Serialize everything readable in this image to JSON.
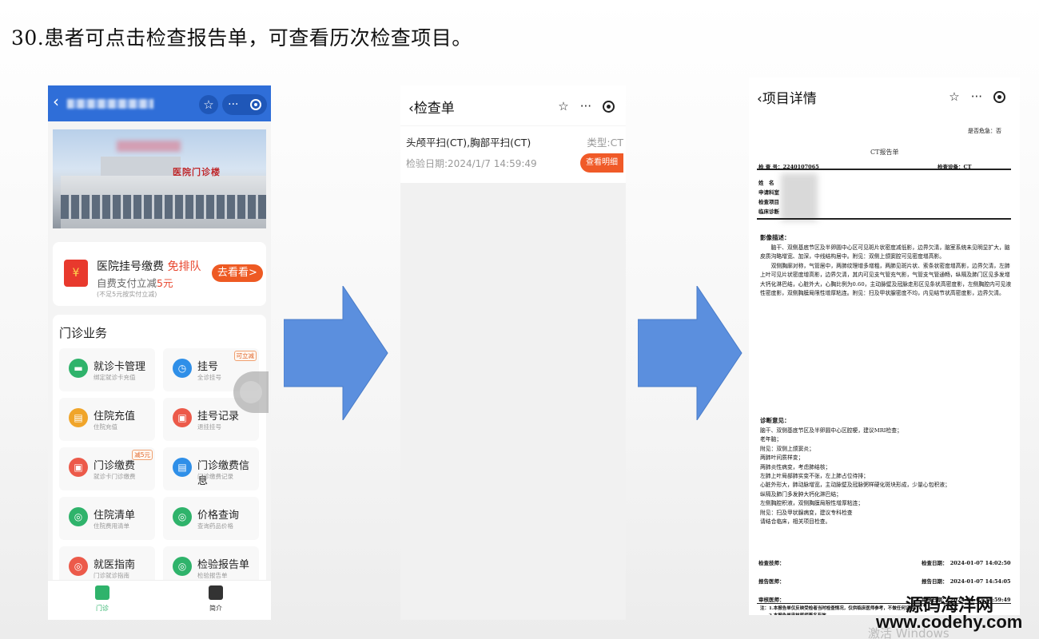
{
  "slide": {
    "title": "30.患者可点击检查报告单，可查看历次检查项目。"
  },
  "phone1": {
    "back_icon": "‹",
    "star_icon": "☆",
    "more_icon": "···",
    "banner_sign": "医院门诊楼",
    "promo": {
      "title": "医院挂号缴费",
      "title_highlight": "免排队",
      "subtitle": "自费支付立减",
      "subtitle_amount": "5元",
      "note": "(不足5元按实付立减)",
      "button": "去看看>"
    },
    "services_title": "门诊业务",
    "tiles": [
      {
        "name": "就诊卡管理",
        "desc": "绑定就诊卡充值",
        "color": "#2fb36b",
        "badge": ""
      },
      {
        "name": "挂号",
        "desc": "全诊挂号",
        "color": "#2f8fe8",
        "badge": "可立减"
      },
      {
        "name": "住院充值",
        "desc": "住院充值",
        "color": "#f0a52a",
        "badge": ""
      },
      {
        "name": "挂号记录",
        "desc": "退挂挂号",
        "color": "#ec5a4a",
        "badge": ""
      },
      {
        "name": "门诊缴费",
        "desc": "就诊卡门诊缴费",
        "color": "#ec5a4a",
        "badge": "减5元"
      },
      {
        "name": "门诊缴费信息",
        "desc": "门诊缴费记录",
        "color": "#2f8fe8",
        "badge": ""
      },
      {
        "name": "住院清单",
        "desc": "住院费用清单",
        "color": "#2fb36b",
        "badge": ""
      },
      {
        "name": "价格查询",
        "desc": "查询药品价格",
        "color": "#2fb36b",
        "badge": ""
      },
      {
        "name": "就医指南",
        "desc": "门诊就诊指南",
        "color": "#ec5a4a",
        "badge": ""
      },
      {
        "name": "检验报告单",
        "desc": "检验报告单",
        "color": "#2fb36b",
        "badge": ""
      }
    ],
    "tabs": [
      {
        "label": "门诊",
        "color": "#2fb36b"
      },
      {
        "label": "简介",
        "color": "#333333"
      }
    ]
  },
  "phone2": {
    "title": "检查单",
    "record": {
      "name": "头颅平扫(CT),胸部平扫(CT)",
      "type": "类型:CT",
      "date": "检验日期:2024/1/7 14:59:49",
      "button": "查看明细"
    }
  },
  "phone3": {
    "title": "项目详情",
    "report": {
      "emergency": "是否危急：否",
      "title": "CT报告单",
      "exam_no": "检 查 号：2240107065",
      "device": "检查设备：CT",
      "fields": [
        "姓　名",
        "申请科室",
        "检查项目",
        "临床诊断"
      ],
      "imaging_title": "影像描述：",
      "imaging_paras": [
        "脑干、双侧基底节区及半卵圆中心区可见斑片状密度减低影，边界欠清，脑室系统未见明显扩大，脑皮质沟略增宽、加深，中线结构居中。附见：双侧上颌窦腔可见密度增高影。",
        "双侧胸廓对称，气管居中，两肺纹理增多增粗，两肺见斑片状、索条状密度增高影，边界欠清，左肺上叶可见片状密度增高影，边界欠清，其内可见支气管充气影，气管支气管通畅，纵隔及肺门区见多发增大钙化淋巴结，心脏外大，心胸比例为0.60，主动脉壁及冠脉走形区见条状高密度影，左侧胸腔内可见液性密度影，双侧胸膜局限性增厚粘连。附见：扫及甲状腺密度不均，内见结节状高密度影，边界欠清。"
      ],
      "diagnosis_title": "诊断意见：",
      "diagnosis_lines": [
        "脑干、双侧基底节区及半卵圆中心区腔梗，建议MRI检查；",
        "老年脑；",
        "附见：双侧上颌窦炎；",
        "两肺叶间质样变；",
        "两肺炎性病变，考虑肺结核；",
        "左肺上叶局部肺实变不张，左上肺占位待排；",
        "心脏外形大，肺动脉增宽，主动脉壁及冠脉粥样硬化斑块形成，少量心包积液；",
        "纵隔及肺门多发肿大钙化淋巴结；",
        "左侧胸腔积液，双侧胸膜局限性增厚粘连；",
        "附见：扫及甲状腺病变，建议专科检查",
        "请结合临床，相关项目检查。"
      ],
      "signatures": [
        {
          "label": "检查技师：",
          "date": "检查日期：　2024-01-07 14:02:50"
        },
        {
          "label": "报告医师：",
          "date": "报告日期：　2024-01-07 14:54:05"
        },
        {
          "label": "审核医师：",
          "date": "审核日期：　2024-01-07 14:59:49"
        }
      ],
      "notes": [
        "注：1.本报告单仅反映受检者当时检查情况，仅供临床医师参考，不做任何证明。",
        "　　2.本报告单审核医师签名有效"
      ]
    }
  },
  "watermark": {
    "line1": "源码海洋网",
    "line2": "www.codehy.com",
    "os_hint": "激活 Windows"
  }
}
